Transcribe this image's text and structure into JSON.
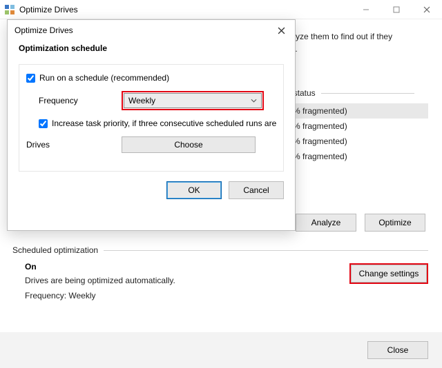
{
  "main": {
    "title": "Optimize Drives",
    "intro_line1": "nalyze them to find out if they",
    "intro_line2": "wn.",
    "status_header": "t status",
    "rows": [
      {
        "text": "% fragmented)"
      },
      {
        "text": "% fragmented)"
      },
      {
        "text": "% fragmented)"
      },
      {
        "text": "% fragmented)"
      }
    ],
    "analyze": "Analyze",
    "optimize": "Optimize",
    "sched_legend": "Scheduled optimization",
    "sched": {
      "on": "On",
      "desc": "Drives are being optimized automatically.",
      "freq": "Frequency: Weekly"
    },
    "change_settings": "Change settings",
    "close": "Close"
  },
  "dialog": {
    "title": "Optimize Drives",
    "heading": "Optimization schedule",
    "run_schedule": "Run on a schedule (recommended)",
    "frequency_label": "Frequency",
    "frequency_value": "Weekly",
    "increase_priority": "Increase task priority, if three consecutive scheduled runs are m",
    "drives_label": "Drives",
    "choose": "Choose",
    "ok": "OK",
    "cancel": "Cancel"
  }
}
